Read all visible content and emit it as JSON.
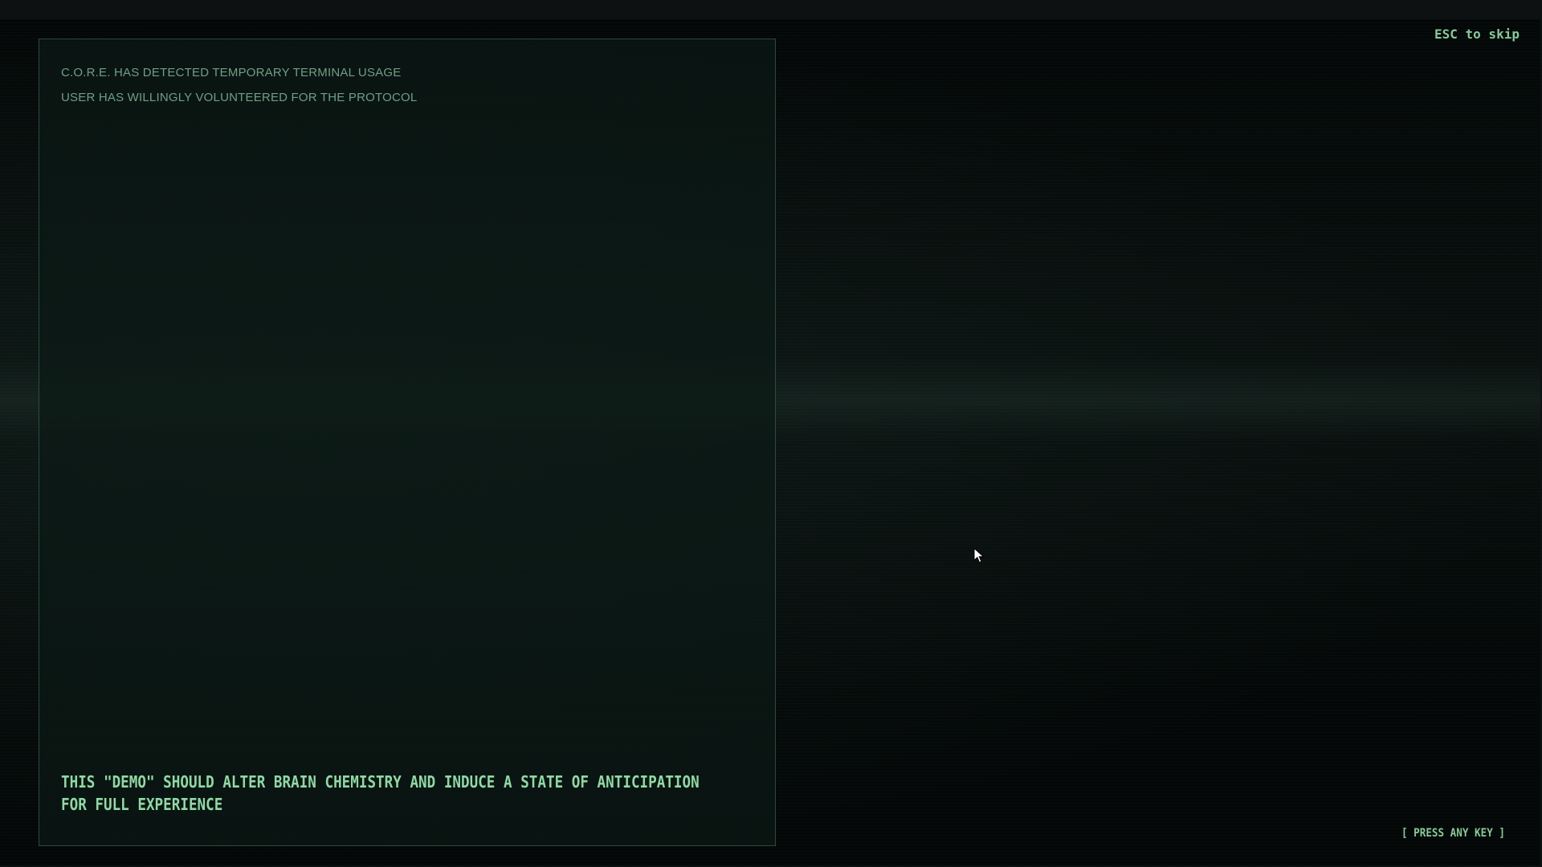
{
  "terminal": {
    "log_lines": [
      "C.O.R.E. HAS DETECTED TEMPORARY TERMINAL USAGE",
      "USER HAS WILLINGLY VOLUNTEERED FOR THE PROTOCOL"
    ],
    "message_line_1": "THIS \"DEMO\" SHOULD ALTER BRAIN CHEMISTRY AND INDUCE A STATE OF ANTICIPATION",
    "message_line_2": "FOR FULL EXPERIENCE"
  },
  "controls": {
    "skip_hint": "ESC to skip",
    "continue_prompt": "[ PRESS ANY KEY ]"
  },
  "icons": {
    "cursor": "mouse-pointer-icon"
  },
  "colors": {
    "text_dim": "#6e9f86",
    "text_bright": "#8fd9a4",
    "panel_border": "#2b4a40",
    "background": "#040606"
  }
}
